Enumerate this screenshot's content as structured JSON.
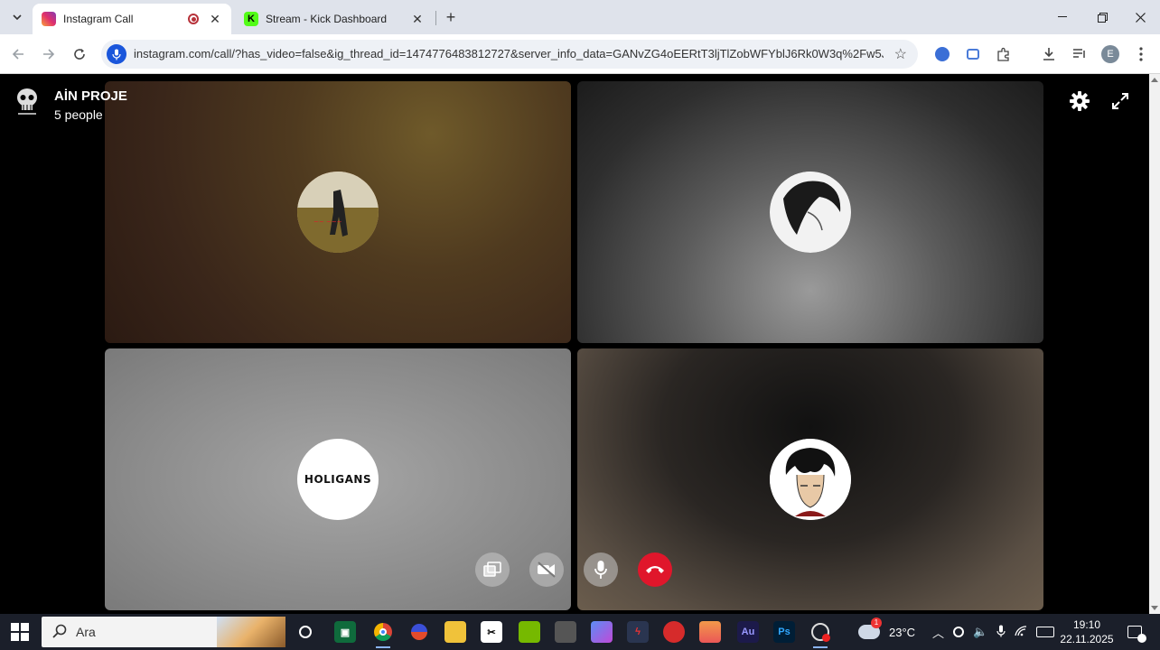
{
  "browser": {
    "tabs": [
      {
        "title": "Instagram Call",
        "active": true
      },
      {
        "title": "Stream - Kick Dashboard",
        "active": false
      }
    ],
    "url": "instagram.com/call/?has_video=false&ig_thread_id=1474776483812727&server_info_data=GANvZG4oEERtT3ljTlZobWFYblJ6Rk0W3q%2Fw5J...",
    "profile_initial": "E"
  },
  "call": {
    "group_name": "AİN PROJE",
    "people_count": "5 people",
    "participants": [
      {
        "avatar": "photo-avatar"
      },
      {
        "avatar": "anime-portrait-avatar"
      },
      {
        "avatar": "holigans-logo-avatar",
        "logo_text": "HOLIGANS"
      },
      {
        "avatar": "anime-portrait-avatar"
      }
    ],
    "controls": [
      "share-screen",
      "camera-off",
      "microphone",
      "end-call"
    ]
  },
  "taskbar": {
    "search_placeholder": "Ara",
    "weather": "23°C",
    "time": "19:10",
    "date": "22.11.2025",
    "weather_badge": "1"
  },
  "colors": {
    "end_call": "#e0162b",
    "mic_badge": "#1a56db",
    "kick_green": "#53fc18"
  }
}
